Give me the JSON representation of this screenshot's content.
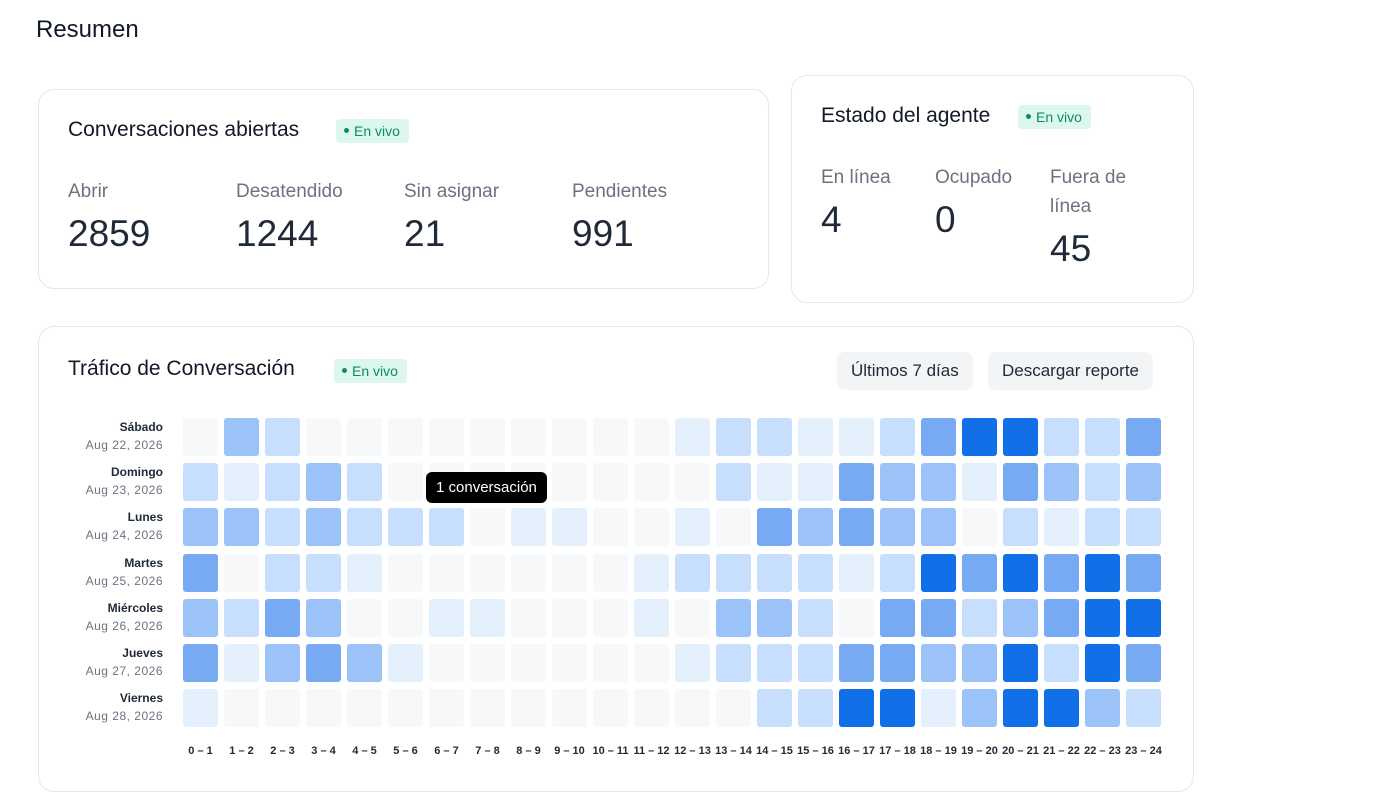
{
  "page": {
    "title": "Resumen"
  },
  "open_conversations": {
    "title": "Conversaciones abiertas",
    "badge": "En vivo",
    "metrics": [
      {
        "label": "Abrir",
        "value": "2859"
      },
      {
        "label": "Desatendido",
        "value": "1244"
      },
      {
        "label": "Sin asignar",
        "value": "21"
      },
      {
        "label": "Pendientes",
        "value": "991"
      }
    ]
  },
  "agent_status": {
    "title": "Estado del agente",
    "badge": "En vivo",
    "metrics": [
      {
        "label": "En línea",
        "value": "4"
      },
      {
        "label": "Ocupado",
        "value": "0"
      },
      {
        "label": "Fuera de línea",
        "value": "45"
      }
    ]
  },
  "traffic": {
    "title": "Tráfico de Conversación",
    "badge": "En vivo",
    "range_button": "Últimos 7 días",
    "download_button": "Descargar reporte",
    "tooltip": "1 conversación",
    "colors": {
      "l0": "#f7f8fa",
      "l1": "#e5f0fd",
      "l2": "#c7defc",
      "l3": "#9cc3f8",
      "l4": "#78aaf4",
      "l5": "#116fe8"
    },
    "hours": [
      "0 – 1",
      "1 – 2",
      "2 – 3",
      "3 – 4",
      "4 – 5",
      "5 – 6",
      "6 – 7",
      "7 – 8",
      "8 – 9",
      "9 – 10",
      "10 – 11",
      "11 – 12",
      "12 – 13",
      "13 – 14",
      "14 – 15",
      "15 – 16",
      "16 – 17",
      "17 – 18",
      "18 – 19",
      "19 – 20",
      "20 – 21",
      "21 – 22",
      "22 – 23",
      "23 – 24"
    ],
    "days": [
      {
        "name": "Sábado",
        "date": "Aug 22, 2026",
        "levels": [
          0,
          3,
          2,
          0,
          0,
          0,
          0,
          0,
          0,
          0,
          0,
          0,
          1,
          2,
          2,
          1,
          1,
          2,
          4,
          5,
          5,
          2,
          2,
          4
        ]
      },
      {
        "name": "Domingo",
        "date": "Aug 23, 2026",
        "levels": [
          2,
          1,
          2,
          3,
          2,
          0,
          0,
          0,
          0,
          0,
          0,
          0,
          0,
          2,
          1,
          1,
          4,
          3,
          3,
          1,
          4,
          3,
          2,
          3
        ]
      },
      {
        "name": "Lunes",
        "date": "Aug 24, 2026",
        "levels": [
          3,
          3,
          2,
          3,
          2,
          2,
          2,
          0,
          1,
          1,
          0,
          0,
          1,
          0,
          4,
          3,
          4,
          3,
          3,
          0,
          2,
          1,
          2,
          2
        ]
      },
      {
        "name": "Martes",
        "date": "Aug 25, 2026",
        "levels": [
          4,
          0,
          2,
          2,
          1,
          0,
          0,
          0,
          0,
          0,
          0,
          1,
          2,
          2,
          2,
          2,
          1,
          2,
          5,
          4,
          5,
          4,
          5,
          4
        ]
      },
      {
        "name": "Miércoles",
        "date": "Aug 26, 2026",
        "levels": [
          3,
          2,
          4,
          3,
          0,
          0,
          1,
          1,
          0,
          0,
          0,
          1,
          0,
          3,
          3,
          2,
          0,
          4,
          4,
          2,
          3,
          4,
          5,
          5
        ]
      },
      {
        "name": "Jueves",
        "date": "Aug 27, 2026",
        "levels": [
          4,
          1,
          3,
          4,
          3,
          1,
          0,
          0,
          0,
          0,
          0,
          0,
          1,
          2,
          2,
          2,
          4,
          4,
          3,
          3,
          5,
          2,
          5,
          4
        ]
      },
      {
        "name": "Viernes",
        "date": "Aug 28, 2026",
        "levels": [
          1,
          0,
          0,
          0,
          0,
          0,
          0,
          0,
          0,
          0,
          0,
          0,
          0,
          0,
          2,
          2,
          5,
          5,
          1,
          3,
          5,
          5,
          3,
          2
        ]
      }
    ]
  }
}
